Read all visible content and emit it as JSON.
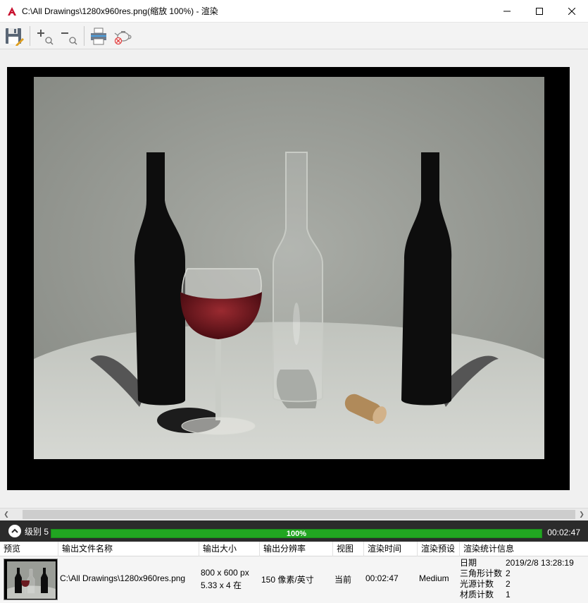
{
  "window": {
    "title": "C:\\All Drawings\\1280x960res.png(缩放 100%) - 渲染"
  },
  "toolbar": {
    "buttons": [
      "save-icon",
      "zoom-in-icon",
      "zoom-out-icon",
      "print-icon",
      "cancel-render-icon"
    ]
  },
  "progress": {
    "level_label": "级别 5",
    "percent_label": "100%",
    "percent": 100,
    "elapsed": "00:02:47"
  },
  "table": {
    "headers": {
      "preview": "预览",
      "filename": "输出文件名称",
      "size": "输出大小",
      "resolution": "输出分辨率",
      "view": "视图",
      "time": "渲染时间",
      "preset": "渲染预设",
      "stats": "渲染统计信息"
    },
    "row": {
      "filename": "C:\\All Drawings\\1280x960res.png",
      "size_px": "800 x 600 px",
      "size_in": "5.33 x 4 在",
      "resolution": "150 像素/英寸",
      "view": "当前",
      "time": "00:02:47",
      "preset": "Medium",
      "stats": {
        "date_key": "日期",
        "date_val": "2019/2/8 13:28:19",
        "tri_key": "三角形计数",
        "tri_val": "2",
        "light_key": "光源计数",
        "light_val": "2",
        "mat_key": "材质计数",
        "mat_val": "1"
      }
    }
  },
  "colors": {
    "progress_green": "#21a621",
    "progress_bg": "#2b2b2b",
    "brand_red": "#c8102e"
  }
}
